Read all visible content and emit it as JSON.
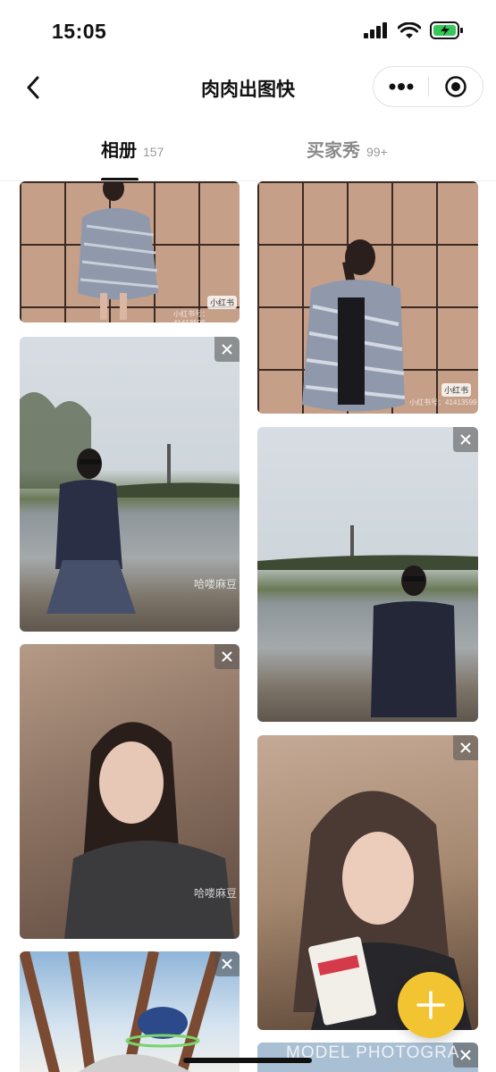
{
  "status_bar": {
    "time": "15:05"
  },
  "nav": {
    "title": "肉肉出图快"
  },
  "tabs": [
    {
      "label": "相册",
      "count": "157"
    },
    {
      "label": "买家秀",
      "count": "99+"
    }
  ],
  "watermark": {
    "badge": "小红书",
    "id": "小红书号：41413599",
    "brand": "哈喽麻豆"
  },
  "footer_text": "MODEL PHOTOGRA",
  "colors": {
    "accent": "#f3c431",
    "text": "#111111",
    "muted": "#999999"
  }
}
